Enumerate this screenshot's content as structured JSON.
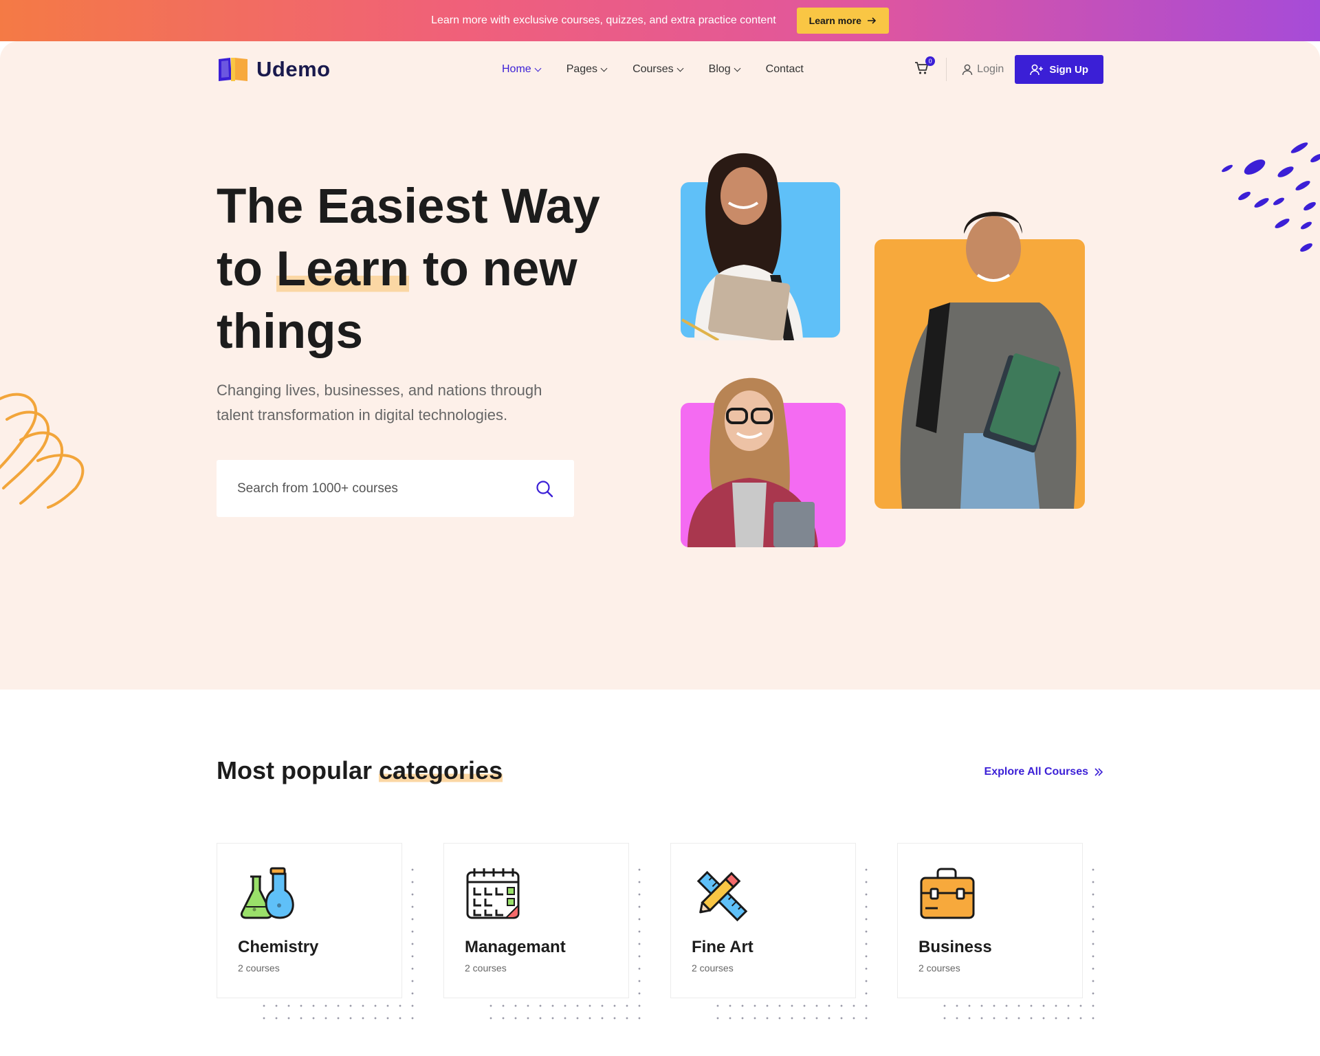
{
  "topbar": {
    "message": "Learn more with exclusive courses, quizzes, and extra practice content",
    "button_label": "Learn more"
  },
  "nav": {
    "logo_text": "Udemo",
    "items": [
      {
        "label": "Home",
        "has_dropdown": true,
        "active": true
      },
      {
        "label": "Pages",
        "has_dropdown": true
      },
      {
        "label": "Courses",
        "has_dropdown": true
      },
      {
        "label": "Blog",
        "has_dropdown": true
      },
      {
        "label": "Contact",
        "has_dropdown": false
      }
    ],
    "cart_count": "0",
    "login_label": "Login",
    "signup_label": "Sign Up"
  },
  "hero": {
    "title_line1": "The Easiest Way",
    "title_to": "to ",
    "title_highlight": "Learn",
    "title_rest": " to new",
    "title_line3": "things",
    "subtitle": "Changing lives, businesses, and nations through talent transformation in digital technologies.",
    "search_placeholder": "Search from 1000+ courses"
  },
  "categories": {
    "title_plain": "Most popular ",
    "title_highlight": "categories",
    "explore_label": "Explore All Courses",
    "items": [
      {
        "name": "Chemistry",
        "count": "2 courses",
        "icon": "flask-icon"
      },
      {
        "name": "Managemant",
        "count": "2 courses",
        "icon": "calendar-icon"
      },
      {
        "name": "Fine Art",
        "count": "2 courses",
        "icon": "pencil-ruler-icon"
      },
      {
        "name": "Business",
        "count": "2 courses",
        "icon": "briefcase-icon"
      }
    ]
  },
  "colors": {
    "primary": "#3b1fd6",
    "hero_bg": "#fdf0e9",
    "accent_yellow": "#f9c644",
    "photo_blue": "#5fc0f8",
    "photo_orange": "#f7a93c",
    "photo_pink": "#f46bf2"
  }
}
